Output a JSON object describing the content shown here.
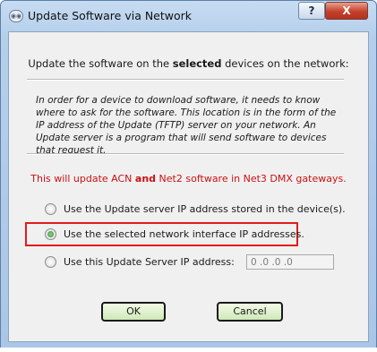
{
  "window": {
    "title": "Update Software via Network",
    "app_icon": "network-app-icon",
    "help_label": "?",
    "close_label": "X"
  },
  "header": {
    "prefix": "Update the software on the ",
    "bold": "selected",
    "suffix": " devices on the network:"
  },
  "info": {
    "text": "In order for a device to download software, it needs to know where to ask for the software. This location is in the form of the IP address of the Update (TFTP) server on your network. An Update server is a program that will send software to devices that request it."
  },
  "warning": {
    "prefix": "This will update ACN ",
    "bold": "and",
    "suffix": " Net2 software in Net3 DMX gateways."
  },
  "options": [
    {
      "label": "Use the Update server IP address stored in the device(s).",
      "selected": false
    },
    {
      "label": "Use the selected network interface IP addresses.",
      "selected": true
    },
    {
      "label": "Use this Update Server IP address:",
      "selected": false
    }
  ],
  "ip_field": {
    "value": "0 .0 .0 .0"
  },
  "buttons": {
    "ok": "OK",
    "cancel": "Cancel"
  },
  "colors": {
    "warning": "#cc1111",
    "highlight_border": "#e01c1c",
    "button_fill": "#cfe8b8",
    "radio_selected": "#2f8a2f"
  }
}
